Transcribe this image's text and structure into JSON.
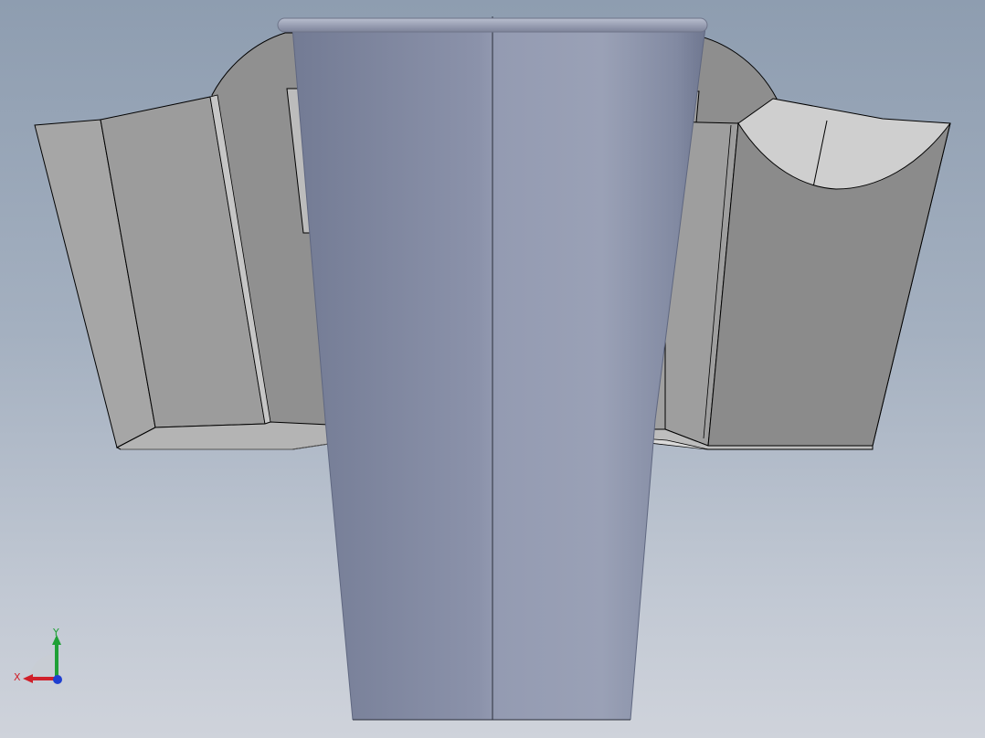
{
  "view": {
    "background_top": "#8e9db0",
    "background_bottom": "#cfd3db",
    "model_cup_color": "#8790a8",
    "model_panel_color": "#9e9e9e"
  },
  "triad": {
    "x_label": "X",
    "y_label": "Y",
    "x_color": "#d0202a",
    "y_color": "#1fa036",
    "z_color": "#1f3fd0"
  }
}
